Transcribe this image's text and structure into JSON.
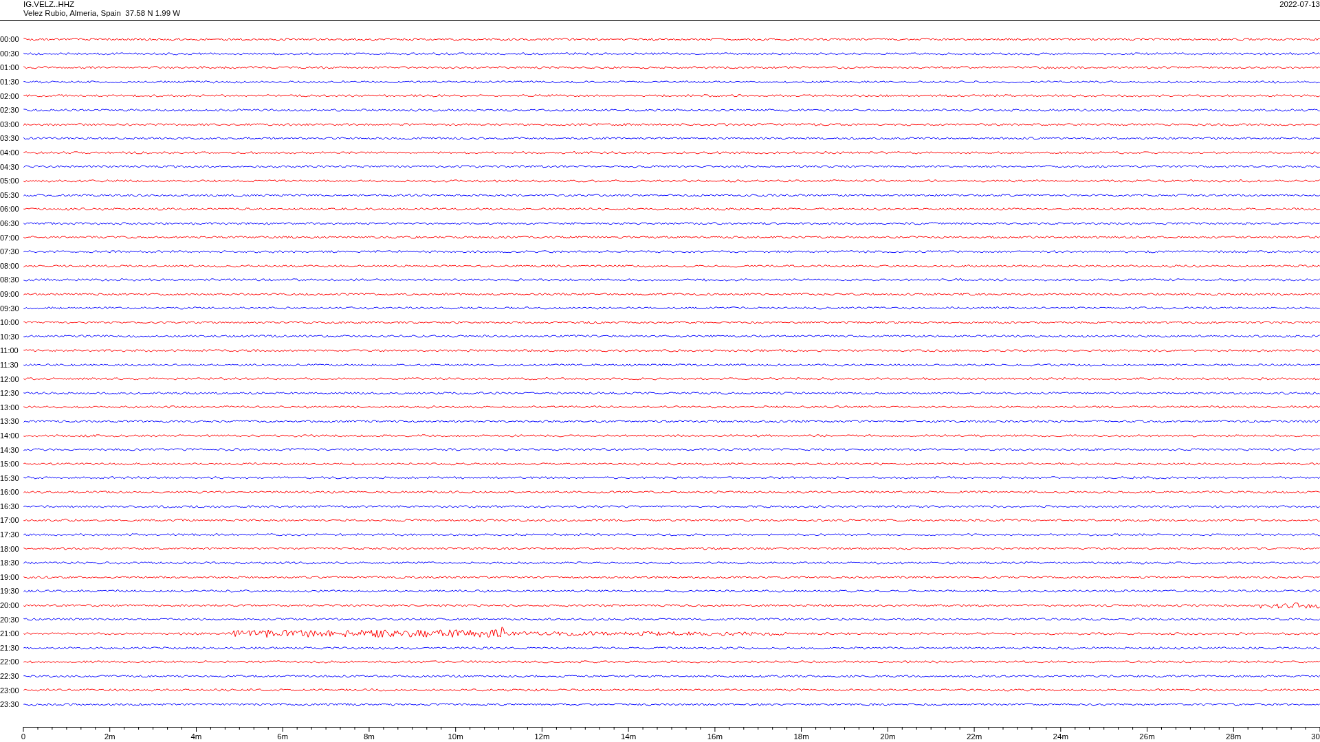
{
  "header": {
    "station": "IG.VELZ..HHZ",
    "location": "Velez Rubio, Almeria, Spain  37.58 N 1.99 W",
    "date": "2022-07-13"
  },
  "rows": [
    {
      "time": "00:00",
      "color": "#ff0000",
      "kind": "quiet"
    },
    {
      "time": "00:30",
      "color": "#0000ff",
      "kind": "quiet"
    },
    {
      "time": "01:00",
      "color": "#ff0000",
      "kind": "quiet"
    },
    {
      "time": "01:30",
      "color": "#0000ff",
      "kind": "quiet"
    },
    {
      "time": "02:00",
      "color": "#ff0000",
      "kind": "quiet"
    },
    {
      "time": "02:30",
      "color": "#0000ff",
      "kind": "quiet"
    },
    {
      "time": "03:00",
      "color": "#ff0000",
      "kind": "quiet"
    },
    {
      "time": "03:30",
      "color": "#0000ff",
      "kind": "quiet"
    },
    {
      "time": "04:00",
      "color": "#ff0000",
      "kind": "quiet"
    },
    {
      "time": "04:30",
      "color": "#0000ff",
      "kind": "quiet"
    },
    {
      "time": "05:00",
      "color": "#ff0000",
      "kind": "quiet"
    },
    {
      "time": "05:30",
      "color": "#0000ff",
      "kind": "quiet"
    },
    {
      "time": "06:00",
      "color": "#ff0000",
      "kind": "quiet"
    },
    {
      "time": "06:30",
      "color": "#0000ff",
      "kind": "quiet"
    },
    {
      "time": "07:00",
      "color": "#ff0000",
      "kind": "quiet"
    },
    {
      "time": "07:30",
      "color": "#0000ff",
      "kind": "quiet"
    },
    {
      "time": "08:00",
      "color": "#ff0000",
      "kind": "quiet"
    },
    {
      "time": "08:30",
      "color": "#0000ff",
      "kind": "quiet"
    },
    {
      "time": "09:00",
      "color": "#ff0000",
      "kind": "quiet"
    },
    {
      "time": "09:30",
      "color": "#0000ff",
      "kind": "quiet"
    },
    {
      "time": "10:00",
      "color": "#ff0000",
      "kind": "quiet"
    },
    {
      "time": "10:30",
      "color": "#0000ff",
      "kind": "quiet"
    },
    {
      "time": "11:00",
      "color": "#ff0000",
      "kind": "quiet"
    },
    {
      "time": "11:30",
      "color": "#0000ff",
      "kind": "quiet"
    },
    {
      "time": "12:00",
      "color": "#ff0000",
      "kind": "quiet"
    },
    {
      "time": "12:30",
      "color": "#0000ff",
      "kind": "quiet"
    },
    {
      "time": "13:00",
      "color": "#ff0000",
      "kind": "quiet"
    },
    {
      "time": "13:30",
      "color": "#0000ff",
      "kind": "quiet"
    },
    {
      "time": "14:00",
      "color": "#ff0000",
      "kind": "quiet"
    },
    {
      "time": "14:30",
      "color": "#0000ff",
      "kind": "quiet"
    },
    {
      "time": "15:00",
      "color": "#ff0000",
      "kind": "quiet"
    },
    {
      "time": "15:30",
      "color": "#0000ff",
      "kind": "quiet"
    },
    {
      "time": "16:00",
      "color": "#ff0000",
      "kind": "quiet"
    },
    {
      "time": "16:30",
      "color": "#0000ff",
      "kind": "quiet"
    },
    {
      "time": "17:00",
      "color": "#ff0000",
      "kind": "quiet"
    },
    {
      "time": "17:30",
      "color": "#0000ff",
      "kind": "quiet"
    },
    {
      "time": "18:00",
      "color": "#ff0000",
      "kind": "quiet"
    },
    {
      "time": "18:30",
      "color": "#0000ff",
      "kind": "quiet"
    },
    {
      "time": "19:00",
      "color": "#ff0000",
      "kind": "quiet"
    },
    {
      "time": "19:30",
      "color": "#0000ff",
      "kind": "quiet"
    },
    {
      "time": "20:00",
      "color": "#ff0000",
      "kind": "burst"
    },
    {
      "time": "20:30",
      "color": "#0000ff",
      "kind": "quiet"
    },
    {
      "time": "21:00",
      "color": "#ff0000",
      "kind": "event"
    },
    {
      "time": "21:30",
      "color": "#0000ff",
      "kind": "quiet"
    },
    {
      "time": "22:00",
      "color": "#ff0000",
      "kind": "quiet"
    },
    {
      "time": "22:30",
      "color": "#0000ff",
      "kind": "quiet"
    },
    {
      "time": "23:00",
      "color": "#ff0000",
      "kind": "quiet"
    },
    {
      "time": "23:30",
      "color": "#0000ff",
      "kind": "quiet"
    }
  ],
  "x_axis": {
    "labels": [
      "0",
      "2m",
      "4m",
      "6m",
      "8m",
      "10m",
      "12m",
      "14m",
      "16m",
      "18m",
      "20m",
      "22m",
      "24m",
      "26m",
      "28m",
      "30"
    ]
  }
}
